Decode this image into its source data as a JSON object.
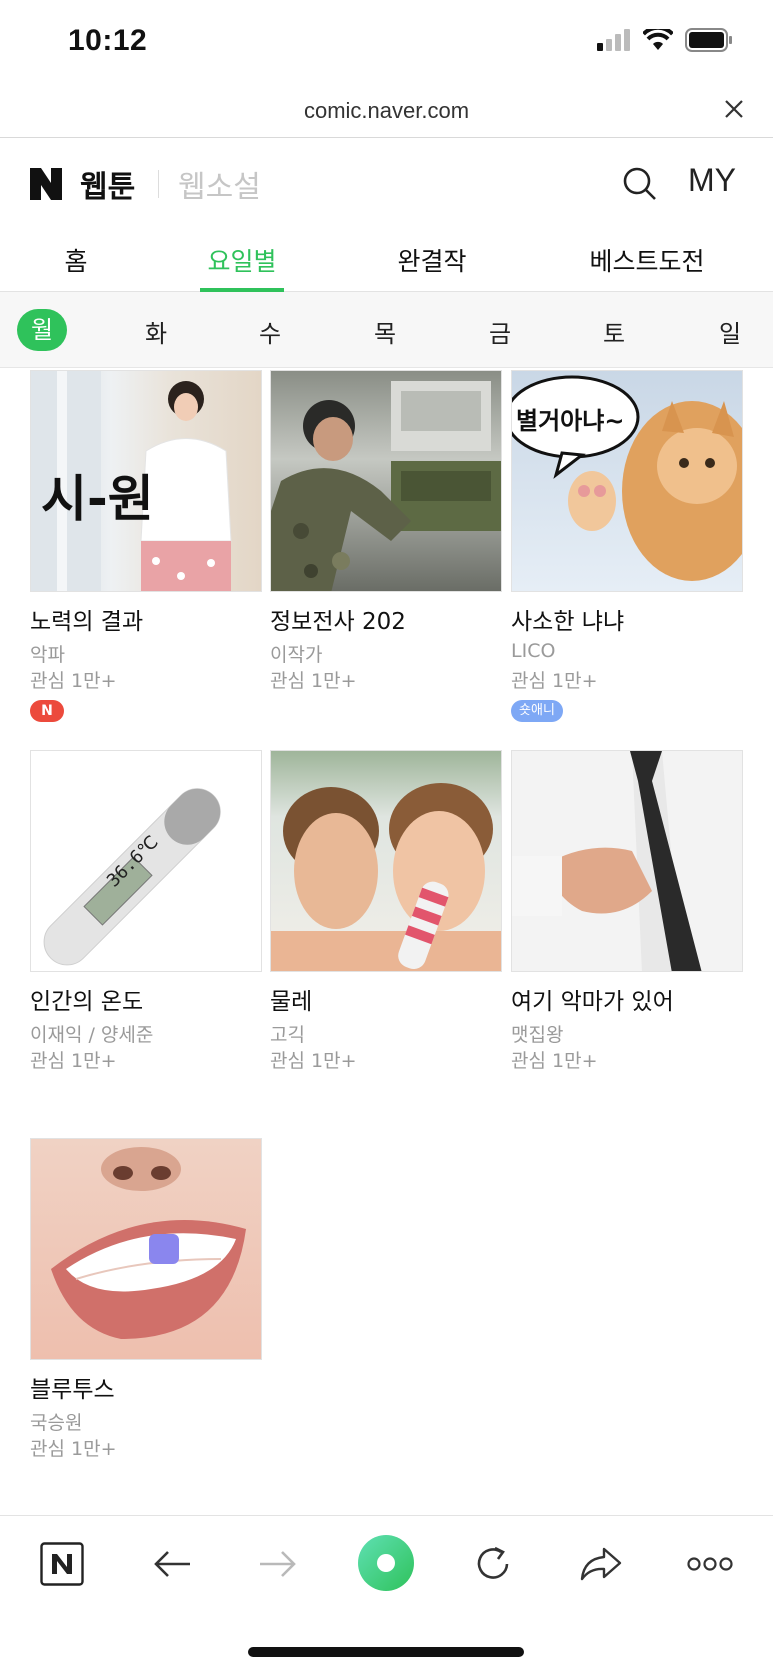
{
  "status": {
    "time": "10:12"
  },
  "browser": {
    "url": "comic.naver.com"
  },
  "header": {
    "webtoon": "웹툰",
    "novel": "웹소설",
    "my": "MY"
  },
  "main_tabs": [
    "홈",
    "요일별",
    "완결작",
    "베스트도전"
  ],
  "days": [
    "월",
    "화",
    "수",
    "목",
    "금",
    "토",
    "일"
  ],
  "cards": [
    {
      "title": "노력의 결과",
      "author": "악파",
      "interest": "관심 1만+",
      "badge": "N",
      "overlay": "시-원"
    },
    {
      "title": "정보전사 202",
      "author": "이작가",
      "interest": "관심 1만+"
    },
    {
      "title": "사소한 냐냐",
      "author": "LICO",
      "interest": "관심 1만+",
      "badge": "숏애니",
      "overlay": "별거아냐~"
    },
    {
      "title": "인간의 온도",
      "author": "이재익 / 양세준",
      "interest": "관심 1만+",
      "overlay": "36.6℃"
    },
    {
      "title": "물레",
      "author": "고긱",
      "interest": "관심 1만+"
    },
    {
      "title": "여기 악마가 있어",
      "author": "맷집왕",
      "interest": "관심 1만+"
    },
    {
      "title": "블루투스",
      "author": "국승원",
      "interest": "관심 1만+"
    }
  ],
  "colors": {
    "accent": "#2fc25b",
    "badge_new": "#ec4a3c",
    "badge_short": "#7ea8f5"
  },
  "icons": [
    "signal-icon",
    "wifi-icon",
    "battery-icon",
    "close-icon",
    "naver-logo",
    "search-icon",
    "home-icon",
    "back-icon",
    "forward-icon",
    "green-dot-icon",
    "refresh-icon",
    "share-icon",
    "more-icon"
  ]
}
